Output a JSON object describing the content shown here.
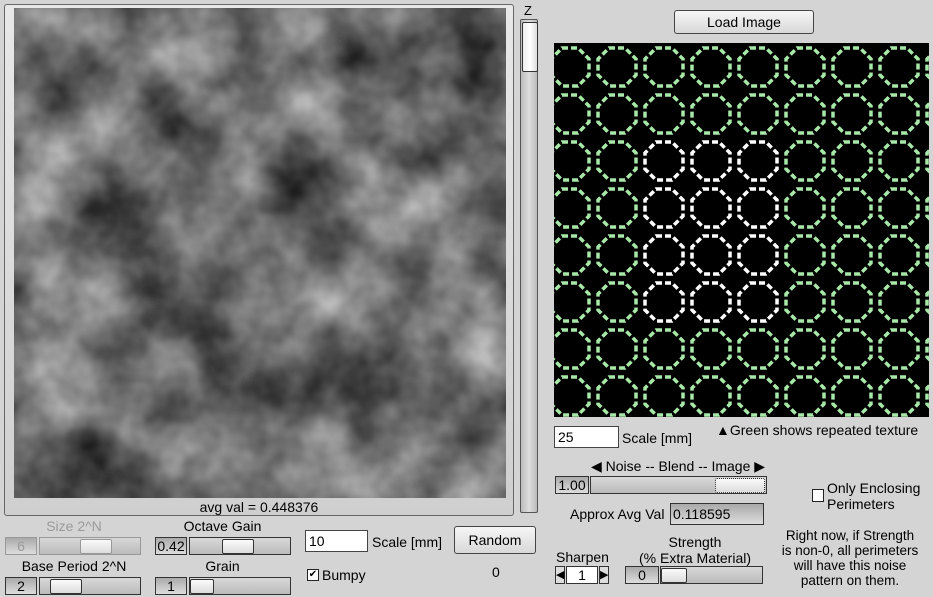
{
  "left": {
    "z_label": "Z",
    "avg_label": "avg val = 0.448376"
  },
  "controls": {
    "size": {
      "label": "Size 2^N",
      "value": "6",
      "fraction": 0.5
    },
    "octave_gain": {
      "label": "Octave Gain",
      "value": "0.42",
      "fraction": 0.42
    },
    "base_period": {
      "label": "Base Period 2^N",
      "value": "2",
      "fraction": 0.12
    },
    "grain": {
      "label": "Grain",
      "value": "1",
      "fraction": 0.0
    },
    "scale": {
      "value": "10",
      "label": "Scale [mm]"
    },
    "random_label": "Random",
    "bumpy": {
      "label": "Bumpy",
      "checked": true
    },
    "counter": "0"
  },
  "right": {
    "load_image": "Load Image",
    "scale": {
      "value": "25",
      "label": "Scale [mm]"
    },
    "green_note": "Green shows repeated texture",
    "blend": {
      "label": "Noise -- Blend -- Image",
      "value": "1.00",
      "fraction": 1.0
    },
    "only_enclosing": {
      "label1": "Only Enclosing",
      "label2": "Perimeters",
      "checked": false
    },
    "approx_avg": {
      "label": "Approx Avg Val",
      "value": "0.118595"
    },
    "sharpen": {
      "label": "Sharpen",
      "value": "1"
    },
    "strength": {
      "label1": "Strength",
      "label2": "(% Extra Material)",
      "value": "0",
      "fraction": 0.0
    },
    "note": [
      "Right now, if Strength",
      "is non-0, all perimeters",
      "will have this noise",
      "pattern on them."
    ],
    "colors": {
      "green": "#a8e8a8",
      "white": "#ffffff"
    }
  }
}
